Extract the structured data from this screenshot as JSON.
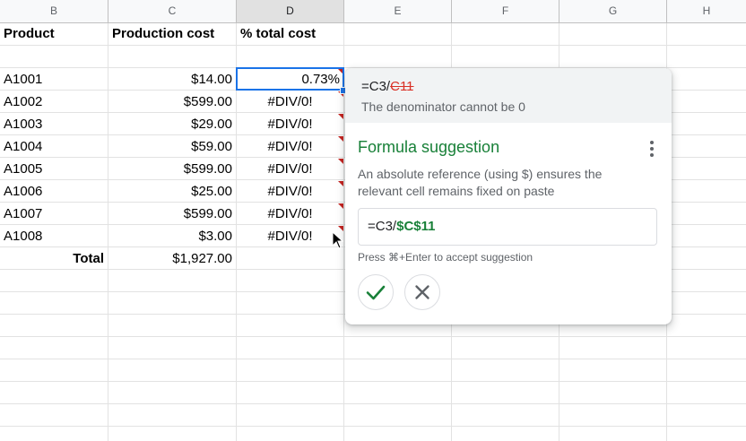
{
  "columns": [
    "B",
    "C",
    "D",
    "E",
    "F",
    "G",
    "H"
  ],
  "headers": {
    "product": "Product",
    "production_cost": "Production cost",
    "pct_total_cost": "% total cost"
  },
  "rows": [
    {
      "product": "A1001",
      "cost": "$14.00",
      "pct": "0.73%"
    },
    {
      "product": "A1002",
      "cost": "$599.00",
      "pct": "#DIV/0!"
    },
    {
      "product": "A1003",
      "cost": "$29.00",
      "pct": "#DIV/0!"
    },
    {
      "product": "A1004",
      "cost": "$59.00",
      "pct": "#DIV/0!"
    },
    {
      "product": "A1005",
      "cost": "$599.00",
      "pct": "#DIV/0!"
    },
    {
      "product": "A1006",
      "cost": "$25.00",
      "pct": "#DIV/0!"
    },
    {
      "product": "A1007",
      "cost": "$599.00",
      "pct": "#DIV/0!"
    },
    {
      "product": "A1008",
      "cost": "$3.00",
      "pct": "#DIV/0!"
    }
  ],
  "total": {
    "label": "Total",
    "value": "$1,927.00"
  },
  "popup": {
    "formula_prefix": "=C3/",
    "formula_wrong_ref": "C11",
    "error_message": "The denominator cannot be 0",
    "suggestion_title": "Formula suggestion",
    "description": "An absolute reference (using $) ensures the relevant cell remains fixed on paste",
    "suggested_prefix": "=C3/",
    "suggested_ref": "$C$11",
    "hint": "Press ⌘+Enter to accept suggestion",
    "accept_icon": "check-icon",
    "reject_icon": "close-icon"
  },
  "colors": {
    "accent_blue": "#1a73e8",
    "suggestion_green": "#188038",
    "error_red": "#d93025"
  }
}
